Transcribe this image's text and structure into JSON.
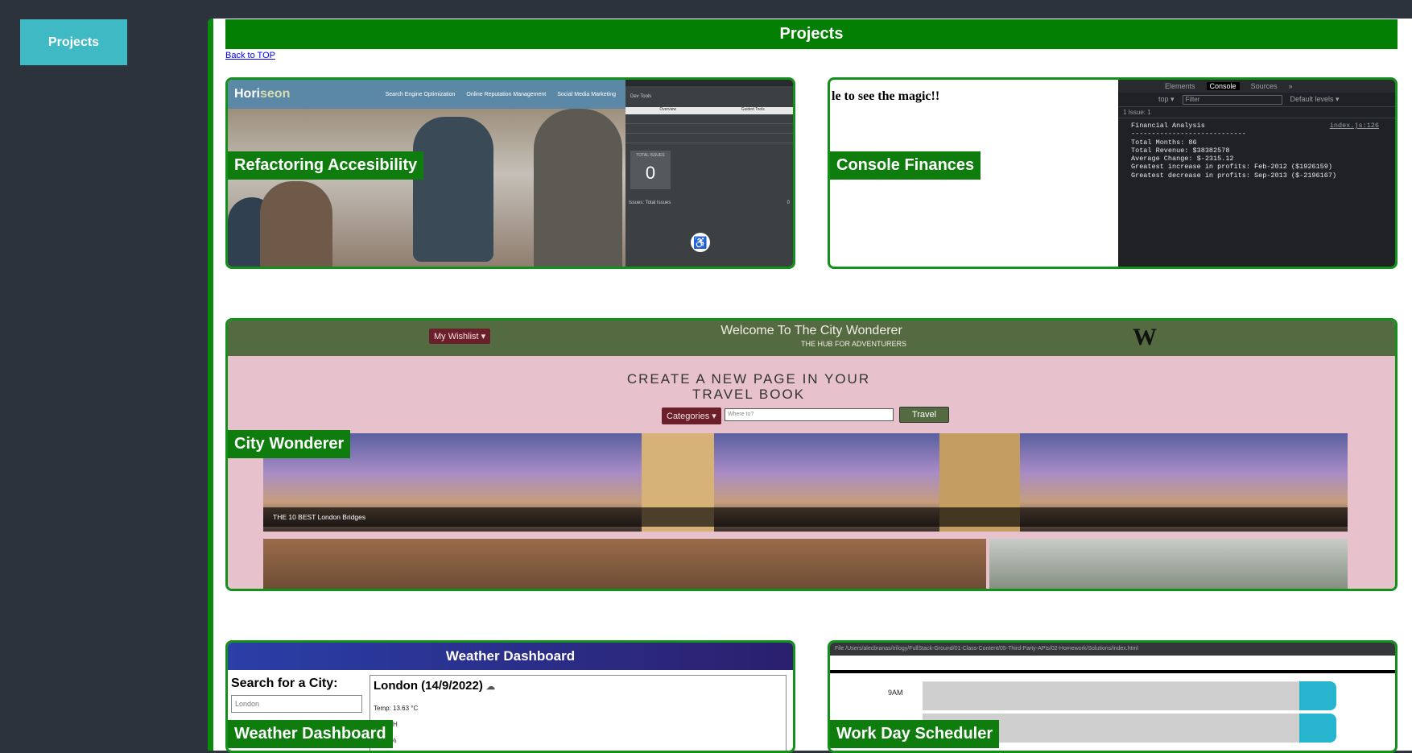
{
  "sidebar": {
    "projects_button": "Projects"
  },
  "header": {
    "title": "Projects"
  },
  "back_link": "Back to TOP",
  "cards": {
    "refactoring": {
      "label": "Refactoring Accesibility",
      "preview": {
        "logo_a": "Hori",
        "logo_b": "seon",
        "nav": [
          "Search Engine Optimization",
          "Online Reputation Management",
          "Social Media Marketing"
        ],
        "devtools_tabs": [
          "Overview",
          "Guided Tools"
        ],
        "devtools_title": "Dev Tools",
        "total_label": "TOTAL ISSUES",
        "total_issues": "0",
        "issues_line": "Issues: Total Issues",
        "issues_count": "0"
      }
    },
    "console_finances": {
      "label": "Console Finances",
      "preview": {
        "page_text": "le to see the magic!!",
        "tabs": [
          "Elements",
          "Console",
          "Sources",
          "»"
        ],
        "context": "top ▾",
        "filter_placeholder": "Filter",
        "levels": "Default levels ▾",
        "issues": "1 Issue: 1",
        "source_link": "index.js:126",
        "log": "Financial Analysis\n----------------------------\nTotal Months: 86\nTotal Revenue: $38382578\nAverage Change: $-2315.12\nGreatest increase in profits: Feb-2012 ($1926159)\nGreatest decrease in profits: Sep-2013 ($-2196167)"
      }
    },
    "city_wonderer": {
      "label": "City Wonderer",
      "preview": {
        "wishlist": "My Wishlist ▾",
        "title": "Welcome To The City Wonderer",
        "subtitle": "THE HUB FOR ADVENTURERS",
        "logo": "W",
        "heading": "CREATE A NEW PAGE IN YOUR TRAVEL BOOK",
        "categories": "Categories ▾",
        "search_placeholder": "Where to?",
        "travel_button": "Travel",
        "caption": "THE 10 BEST London Bridges"
      }
    },
    "weather": {
      "label": "Weather Dashboard",
      "preview": {
        "title": "Weather Dashboard",
        "search_label": "Search for a City:",
        "search_value": "London",
        "city_date": "London (14/9/2022)",
        "temp": "Temp: 13.63 °C",
        "wind": "1.7 KPH",
        "humidity": "ity: 84%"
      }
    },
    "scheduler": {
      "label": "Work Day Scheduler",
      "preview": {
        "address": "File  /Users/alecbranas/trilogy/FullStack-Ground/01-Class-Content/05-Third-Party-APIs/02-Homework/Solutions/index.html",
        "hour": "9AM"
      }
    }
  }
}
